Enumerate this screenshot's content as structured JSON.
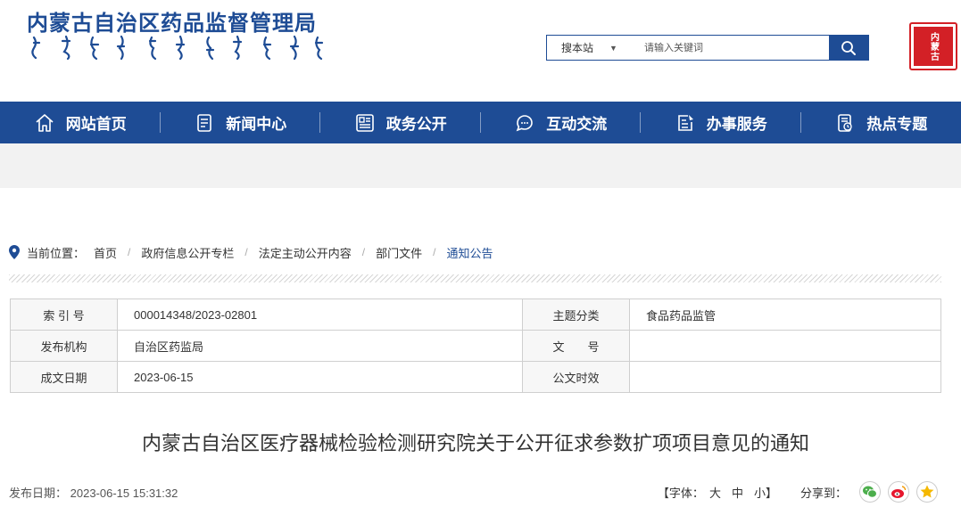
{
  "header": {
    "site_title": "内蒙古自治区药品监督管理局",
    "seal_text": "内蒙古",
    "search": {
      "scope": "搜本站",
      "placeholder": "请输入关键词"
    }
  },
  "nav": {
    "items": [
      {
        "label": "网站首页",
        "icon": "home-icon"
      },
      {
        "label": "新闻中心",
        "icon": "news-icon"
      },
      {
        "label": "政务公开",
        "icon": "gov-info-icon"
      },
      {
        "label": "互动交流",
        "icon": "chat-icon"
      },
      {
        "label": "办事服务",
        "icon": "service-icon"
      },
      {
        "label": "热点专题",
        "icon": "topic-icon"
      }
    ]
  },
  "breadcrumb": {
    "label": "当前位置：",
    "items": [
      "首页",
      "政府信息公开专栏",
      "法定主动公开内容",
      "部门文件",
      "通知公告"
    ]
  },
  "info_table": {
    "index_label": "索 引 号",
    "index_value": "000014348/2023-02801",
    "subject_label": "主题分类",
    "subject_value": "食品药品监管",
    "org_label": "发布机构",
    "org_value": "自治区药监局",
    "docno_label": "文　　号",
    "docno_value": "",
    "date_label": "成文日期",
    "date_value": "2023-06-15",
    "validity_label": "公文时效",
    "validity_value": ""
  },
  "article": {
    "title": "内蒙古自治区医疗器械检验检测研究院关于公开征求参数扩项项目意见的通知",
    "publish_label": "发布日期：",
    "publish_time": "2023-06-15 15:31:32",
    "font_label": "【字体：",
    "font_large": "大",
    "font_medium": "中",
    "font_small": "小】",
    "share_label": "分享到："
  },
  "colors": {
    "brand_blue": "#1e4c95",
    "seal_red": "#d32026",
    "band_grey": "#f2f2f2"
  }
}
